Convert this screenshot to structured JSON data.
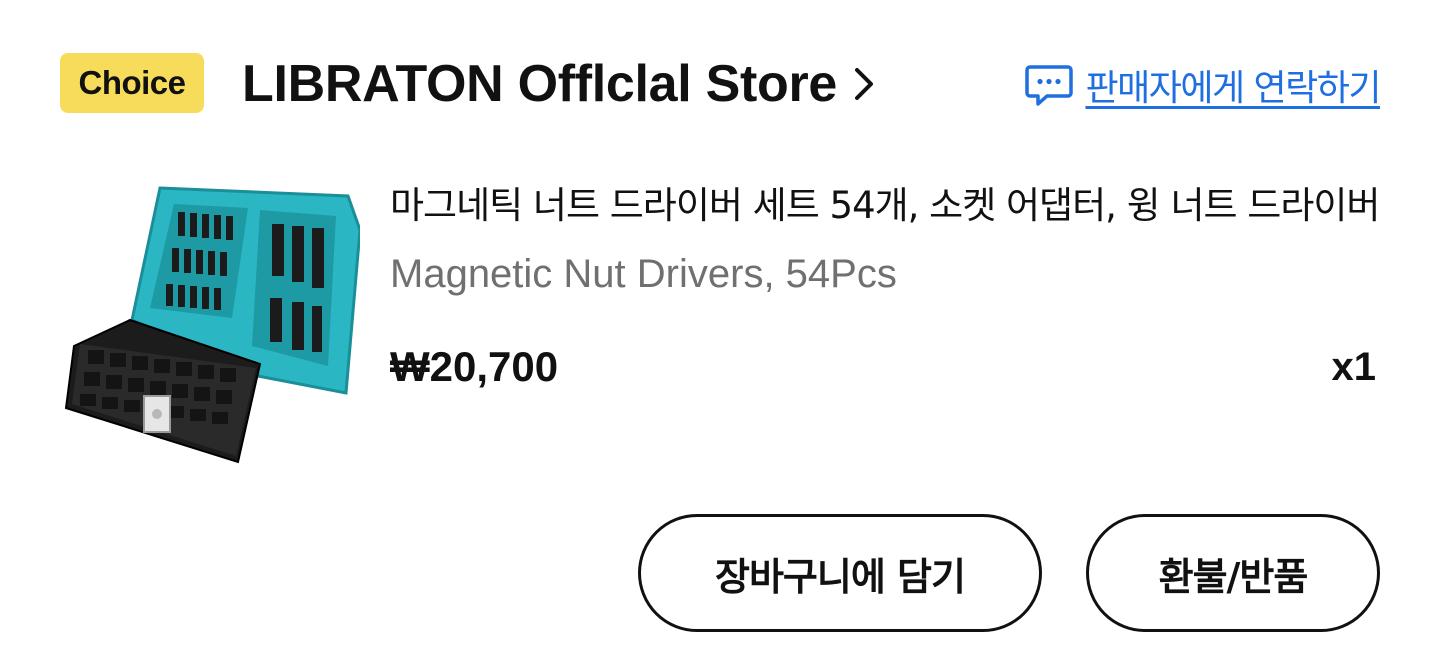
{
  "store": {
    "badge_label": "Choice",
    "name": "LIBRATON Offlclal Store",
    "contact_label": "판매자에게 연락하기"
  },
  "product": {
    "title": "마그네틱 너트 드라이버 세트 54개, 소켓 어댑터, 윙 너트 드라이버",
    "subtitle": "Magnetic Nut Drivers, 54Pcs",
    "price": "₩20,700",
    "quantity": "x1",
    "image_icon": "tool-case-icon"
  },
  "actions": {
    "add_to_cart_label": "장바구니에 담기",
    "refund_label": "환불/반품"
  },
  "colors": {
    "badge_background": "#f6dc5a",
    "link_blue": "#1f6fe0",
    "case_teal": "#2ab7c3",
    "subtitle_gray": "#707070"
  }
}
